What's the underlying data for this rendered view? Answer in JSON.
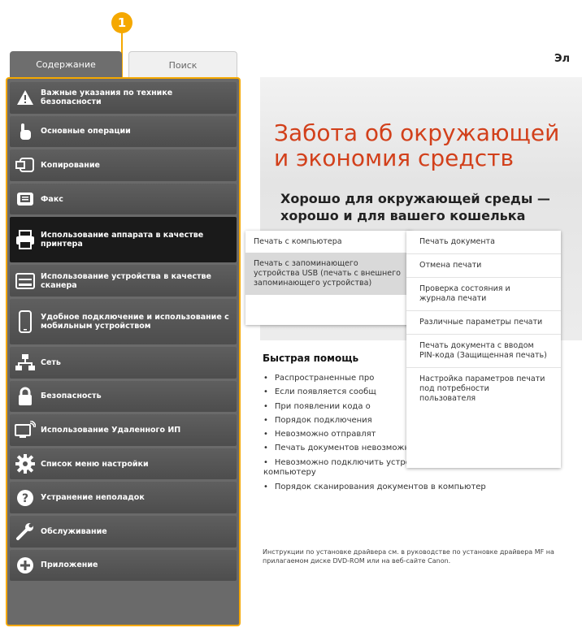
{
  "callout": "1",
  "tabs": {
    "contents": "Содержание",
    "search": "Поиск"
  },
  "top_right": "Эл",
  "sidebar": [
    {
      "label": "Важные указания по технике безопасности",
      "icon": "warning-icon"
    },
    {
      "label": "Основные операции",
      "icon": "hand-icon"
    },
    {
      "label": "Копирование",
      "icon": "copy-icon"
    },
    {
      "label": "Факс",
      "icon": "fax-icon"
    },
    {
      "label": "Использование аппарата в качестве принтера",
      "icon": "printer-icon"
    },
    {
      "label": "Использование устройства в качестве сканера",
      "icon": "scanner-icon"
    },
    {
      "label": "Удобное подключение и использование с мобильным устройством",
      "icon": "mobile-icon"
    },
    {
      "label": "Сеть",
      "icon": "network-icon"
    },
    {
      "label": "Безопасность",
      "icon": "lock-icon"
    },
    {
      "label": "Использование Удаленного ИП",
      "icon": "remote-ui-icon"
    },
    {
      "label": "Список меню настройки",
      "icon": "gear-icon"
    },
    {
      "label": "Устранение неполадок",
      "icon": "question-icon"
    },
    {
      "label": "Обслуживание",
      "icon": "wrench-icon"
    },
    {
      "label": "Приложение",
      "icon": "plus-icon"
    }
  ],
  "banner": {
    "title1": "Забота об окружающей",
    "title2": "и экономия средств",
    "sub1": "Хорошо для окружающей среды —",
    "sub2": "хорошо и для вашего кошелька"
  },
  "submenu1": [
    "Печать с компьютера",
    "Печать с запоминающего устройства USB (печать с внешнего запоминающего устройства)"
  ],
  "submenu2": [
    "Печать документа",
    "Отмена печати",
    "Проверка состояния и журнала печати",
    "Различные параметры печати",
    "Печать документа с вводом PIN-кода (Защищенная печать)",
    "Настройка параметров печати под потребности пользователя"
  ],
  "quick_help": {
    "title": "Быстрая помощь",
    "items": [
      "Распространенные про",
      "Если появляется сообщ",
      "При появлении кода о",
      "Порядок подключения",
      "Невозможно отправлят",
      "Печать документов невозможна",
      "Невозможно подключить устройство к сетевому компьютеру",
      "Порядок сканирования документов в компьютер"
    ],
    "note": "Инструкции по установке драйвера см. в руководстве по установке драйвера MF на прилагаемом диске DVD-ROM или на веб-сайте Canon."
  }
}
